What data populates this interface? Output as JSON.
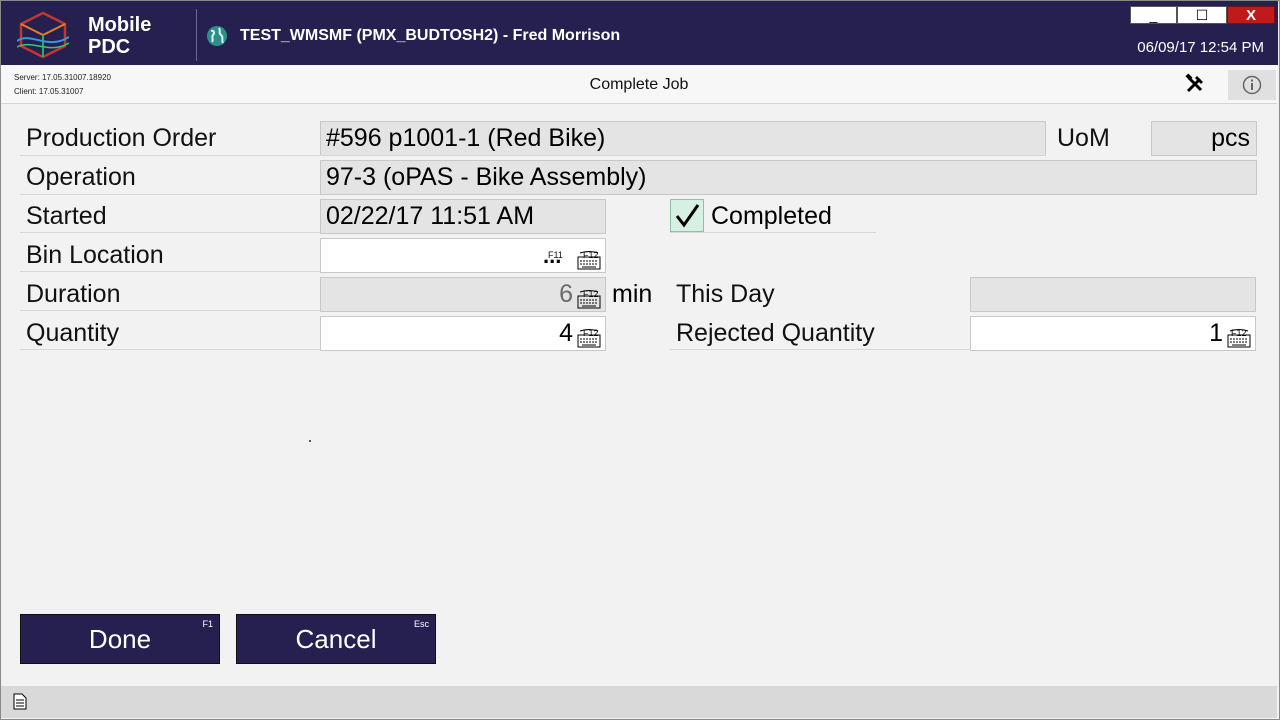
{
  "app": {
    "brand_line1": "Mobile",
    "brand_line2": "PDC",
    "window_title": "TEST_WMSMF (PMX_BUDTOSH2) - Fred Morrison",
    "datetime": "06/09/17 12:54 PM"
  },
  "window_controls": {
    "minimize": "_",
    "maximize": "☐",
    "close": "X"
  },
  "subheader": {
    "server_version": "Server: 17.05.31007.18920",
    "client_version": "Client: 17.05.31007",
    "page_title": "Complete Job"
  },
  "form": {
    "production_order": {
      "label": "Production Order",
      "value": "#596 p1001-1 (Red Bike)"
    },
    "uom": {
      "label": "UoM",
      "value": "pcs"
    },
    "operation": {
      "label": "Operation",
      "value": "97-3 (oPAS - Bike Assembly)"
    },
    "started": {
      "label": "Started",
      "value": "02/22/17 11:51 AM"
    },
    "completed": {
      "label": "Completed",
      "checked": true
    },
    "bin_location": {
      "label": "Bin Location",
      "value": "",
      "ellipsis": "...",
      "f11": "F11",
      "f12": "F12"
    },
    "duration": {
      "label": "Duration",
      "value": "6",
      "unit": "min",
      "f12": "F12"
    },
    "this_day": {
      "label": "This Day",
      "value": ""
    },
    "quantity": {
      "label": "Quantity",
      "value": "4",
      "f12": "F12"
    },
    "rejected_quantity": {
      "label": "Rejected Quantity",
      "value": "1",
      "f12": "F12"
    }
  },
  "buttons": {
    "done": "Done",
    "done_key": "F1",
    "cancel": "Cancel",
    "cancel_key": "Esc"
  },
  "colors": {
    "titlebar": "#262050",
    "button": "#262050",
    "close": "#c11a1a",
    "checkbox": "#d6f0e3"
  }
}
